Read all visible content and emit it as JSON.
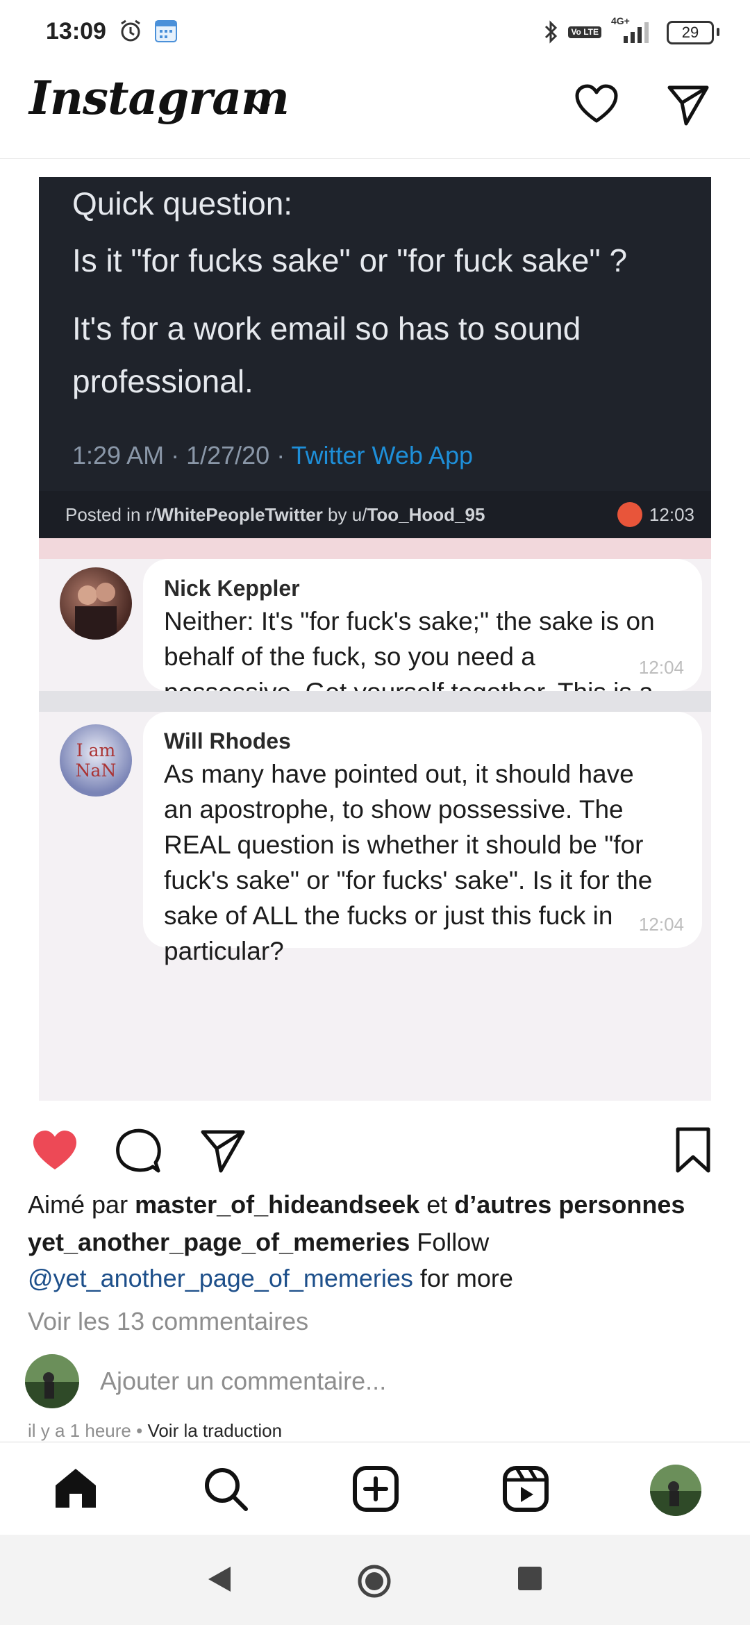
{
  "status_bar": {
    "time": "13:09",
    "icons": [
      "alarm-icon",
      "calendar-icon",
      "bluetooth-icon",
      "volte-icon",
      "signal-icon",
      "battery-icon"
    ],
    "volte": "Vo LTE",
    "network": "4G+",
    "battery": "29"
  },
  "header": {
    "logo": "Instagram",
    "icons": [
      "chevron-down-icon",
      "heart-icon",
      "send-icon"
    ]
  },
  "post_image": {
    "tweet_lines": [
      "Quick question:",
      "Is it \"for fucks sake\" or \"for fuck sake\" ?",
      "It's for a work email so has to sound",
      "professional."
    ],
    "tweet_meta": "1:29 AM · 1/27/20 · ",
    "tweet_source": "Twitter Web App",
    "posted_prefix": "Posted in r/",
    "subreddit": "WhitePeopleTwitter",
    "posted_by": " by u/",
    "username": "Too_Hood_95",
    "posted_time": "12:03",
    "comments": [
      {
        "name": "Nick Keppler",
        "text": "Neither: It's \"for fuck's sake;\" the sake is on behalf of the fuck, so you need a possessive. Get yourself together. This is a workplace.",
        "time": "12:04"
      },
      {
        "name": "Will Rhodes",
        "avatar_text": "I am NaN",
        "text": "As many have pointed out, it should have an apostrophe, to show possessive. The REAL question is whether it should be \"for fuck's sake\" or \"for fucks' sake\". Is it for the sake of ALL the fucks or just this fuck in particular?",
        "time": "12:04"
      }
    ]
  },
  "actions": {
    "icons": [
      "heart-filled-icon",
      "comment-icon",
      "share-icon",
      "bookmark-icon"
    ],
    "like_color": "#ed4956"
  },
  "post_meta": {
    "liked_prefix": "Aimé par ",
    "liked_user": "master_of_hideandseek",
    "liked_mid": " et ",
    "liked_others": "d’autres personnes",
    "author": "yet_another_page_of_memeries",
    "caption_follow": " Follow",
    "mention": "@yet_another_page_of_memeries",
    "caption_rest": " for more",
    "view_comments": "Voir les 13 commentaires",
    "add_comment_placeholder": "Ajouter un commentaire...",
    "time_ago": "il y a 1 heure",
    "dot": " • ",
    "see_translation": "Voir la traduction"
  },
  "bottom_nav": {
    "items": [
      "home-icon",
      "search-icon",
      "create-icon",
      "reels-icon",
      "profile-avatar"
    ]
  },
  "system_nav": {
    "items": [
      "back-button",
      "home-button",
      "recents-button"
    ]
  }
}
